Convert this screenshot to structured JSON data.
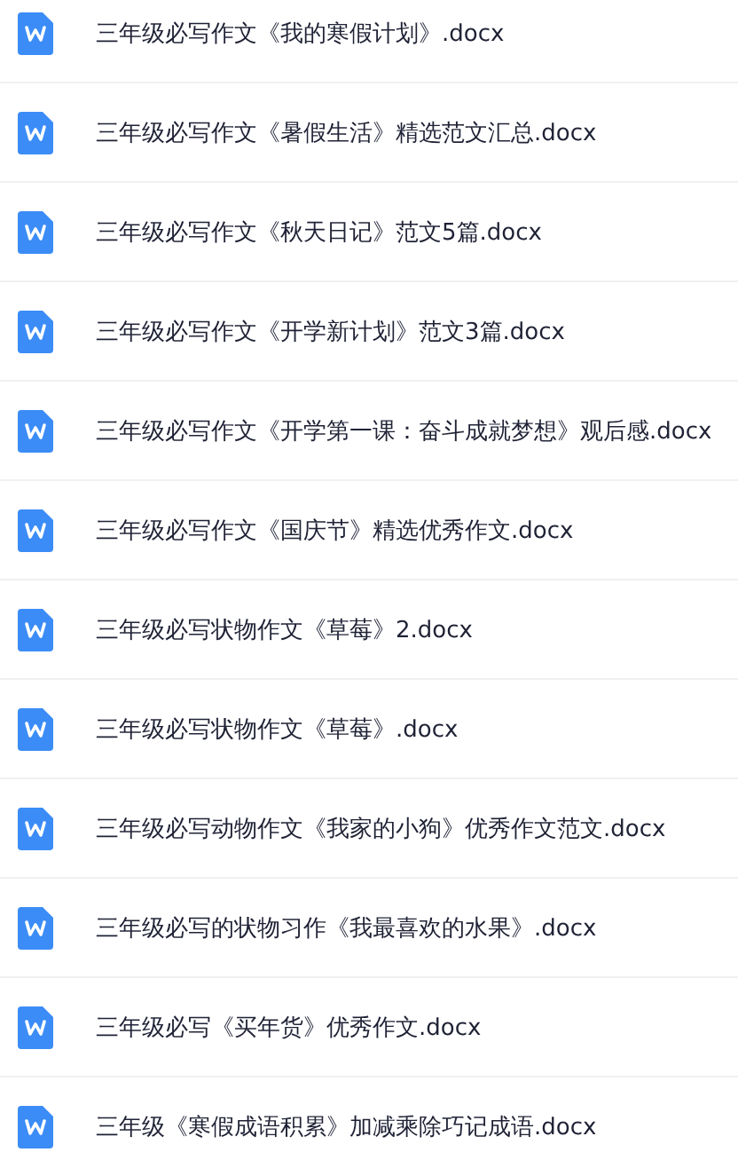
{
  "files": [
    {
      "name": "三年级必写作文《我的寒假计划》.docx"
    },
    {
      "name": "三年级必写作文《暑假生活》精选范文汇总.docx"
    },
    {
      "name": "三年级必写作文《秋天日记》范文5篇.docx"
    },
    {
      "name": "三年级必写作文《开学新计划》范文3篇.docx"
    },
    {
      "name": "三年级必写作文《开学第一课：奋斗成就梦想》观后感.docx"
    },
    {
      "name": "三年级必写作文《国庆节》精选优秀作文.docx"
    },
    {
      "name": "三年级必写状物作文《草莓》2.docx"
    },
    {
      "name": "三年级必写状物作文《草莓》.docx"
    },
    {
      "name": "三年级必写动物作文《我家的小狗》优秀作文范文.docx"
    },
    {
      "name": "三年级必写的状物习作《我最喜欢的水果》.docx"
    },
    {
      "name": "三年级必写《买年货》优秀作文.docx"
    },
    {
      "name": "三年级《寒假成语积累》加减乘除巧记成语.docx"
    }
  ]
}
